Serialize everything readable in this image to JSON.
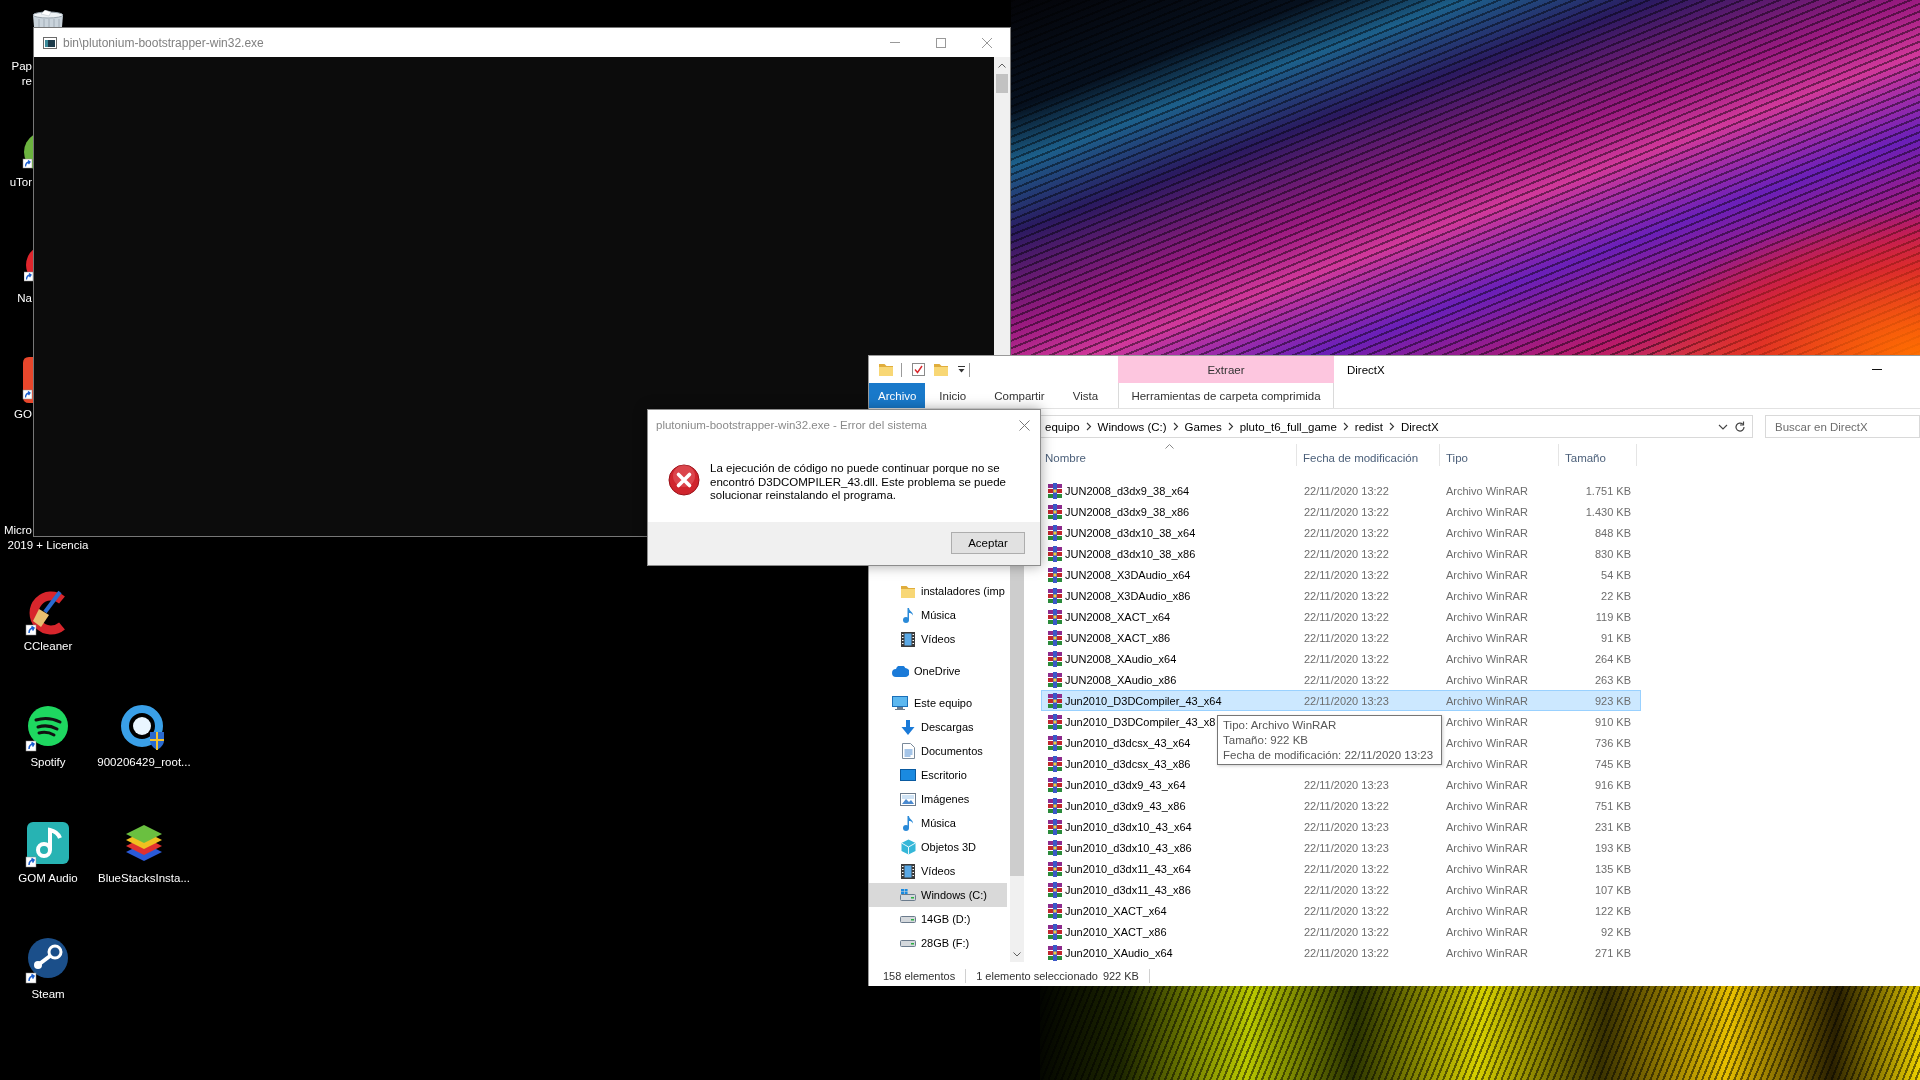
{
  "desktop_icons": [
    {
      "label_lines": [
        "Pap",
        "re"
      ]
    },
    {
      "label_lines": [
        "uTor"
      ]
    },
    {
      "label_lines": [
        "Na"
      ]
    },
    {
      "label_lines": [
        "GO"
      ]
    },
    {
      "label_lines": [
        "Micro",
        "2019 + Licencia"
      ]
    },
    {
      "label_lines": [
        "CCleaner"
      ]
    },
    {
      "label_lines": [
        "Spotify"
      ]
    },
    {
      "label_lines": [
        "900206429_root..."
      ]
    },
    {
      "label_lines": [
        "GOM Audio"
      ]
    },
    {
      "label_lines": [
        "BlueStacksInsta..."
      ]
    },
    {
      "label_lines": [
        "Steam"
      ]
    }
  ],
  "console_window": {
    "title": "bin\\plutonium-bootstrapper-win32.exe"
  },
  "explorer": {
    "title": "DirectX",
    "ribbon": {
      "contextual_group": "Extraer",
      "tabs": [
        {
          "label": "Archivo",
          "kind": "file",
          "selected": false
        },
        {
          "label": "Inicio",
          "kind": "standard",
          "selected": false
        },
        {
          "label": "Compartir",
          "kind": "standard",
          "selected": false
        },
        {
          "label": "Vista",
          "kind": "standard",
          "selected": false
        },
        {
          "label": "Herramientas de carpeta comprimida",
          "kind": "contextual",
          "selected": false
        }
      ]
    },
    "address_bar": {
      "breadcrumbs": [
        "equipo",
        "Windows (C:)",
        "Games",
        "pluto_t6_full_game",
        "redist",
        "DirectX"
      ]
    },
    "search": {
      "placeholder": "Buscar en DirectX"
    },
    "navigation": {
      "quick_access_items": [
        {
          "label": "instaladores (imp",
          "selected": false
        },
        {
          "label": "Música",
          "selected": false
        },
        {
          "label": "Vídeos",
          "selected": false
        }
      ],
      "tree": [
        {
          "label": "OneDrive",
          "selected": false
        },
        {
          "label": "Este equipo",
          "selected": false,
          "children": [
            {
              "label": "Descargas",
              "selected": false
            },
            {
              "label": "Documentos",
              "selected": false
            },
            {
              "label": "Escritorio",
              "selected": false
            },
            {
              "label": "Imágenes",
              "selected": false
            },
            {
              "label": "Música",
              "selected": false
            },
            {
              "label": "Objetos 3D",
              "selected": false
            },
            {
              "label": "Vídeos",
              "selected": false
            },
            {
              "label": "Windows (C:)",
              "selected": true
            },
            {
              "label": "14GB (D:)",
              "selected": false
            },
            {
              "label": "28GB (F:)",
              "selected": false
            }
          ]
        }
      ]
    },
    "file_list": {
      "columns": [
        {
          "label": "Nombre",
          "sorted": true
        },
        {
          "label": "Fecha de modificación",
          "sorted": false
        },
        {
          "label": "Tipo",
          "sorted": false
        },
        {
          "label": "Tamaño",
          "sorted": false
        }
      ],
      "rows": [
        {
          "name": "JUN2008_d3dx9_38_x64",
          "date": "22/11/2020 13:22",
          "type": "Archivo WinRAR",
          "size": "1.751 KB",
          "selected": false
        },
        {
          "name": "JUN2008_d3dx9_38_x86",
          "date": "22/11/2020 13:22",
          "type": "Archivo WinRAR",
          "size": "1.430 KB",
          "selected": false
        },
        {
          "name": "JUN2008_d3dx10_38_x64",
          "date": "22/11/2020 13:22",
          "type": "Archivo WinRAR",
          "size": "848 KB",
          "selected": false
        },
        {
          "name": "JUN2008_d3dx10_38_x86",
          "date": "22/11/2020 13:22",
          "type": "Archivo WinRAR",
          "size": "830 KB",
          "selected": false
        },
        {
          "name": "JUN2008_X3DAudio_x64",
          "date": "22/11/2020 13:22",
          "type": "Archivo WinRAR",
          "size": "54 KB",
          "selected": false
        },
        {
          "name": "JUN2008_X3DAudio_x86",
          "date": "22/11/2020 13:22",
          "type": "Archivo WinRAR",
          "size": "22 KB",
          "selected": false
        },
        {
          "name": "JUN2008_XACT_x64",
          "date": "22/11/2020 13:22",
          "type": "Archivo WinRAR",
          "size": "119 KB",
          "selected": false
        },
        {
          "name": "JUN2008_XACT_x86",
          "date": "22/11/2020 13:22",
          "type": "Archivo WinRAR",
          "size": "91 KB",
          "selected": false
        },
        {
          "name": "JUN2008_XAudio_x64",
          "date": "22/11/2020 13:22",
          "type": "Archivo WinRAR",
          "size": "264 KB",
          "selected": false
        },
        {
          "name": "JUN2008_XAudio_x86",
          "date": "22/11/2020 13:22",
          "type": "Archivo WinRAR",
          "size": "263 KB",
          "selected": false
        },
        {
          "name": "Jun2010_D3DCompiler_43_x64",
          "date": "22/11/2020 13:23",
          "type": "Archivo WinRAR",
          "size": "923 KB",
          "selected": true
        },
        {
          "name": "Jun2010_D3DCompiler_43_x8",
          "type": "Archivo WinRAR",
          "size": "910 KB",
          "selected": false
        },
        {
          "name": "Jun2010_d3dcsx_43_x64",
          "type": "Archivo WinRAR",
          "size": "736 KB",
          "selected": false
        },
        {
          "name": "Jun2010_d3dcsx_43_x86",
          "type": "Archivo WinRAR",
          "size": "745 KB",
          "selected": false
        },
        {
          "name": "Jun2010_d3dx9_43_x64",
          "date": "22/11/2020 13:23",
          "type": "Archivo WinRAR",
          "size": "916 KB",
          "selected": false
        },
        {
          "name": "Jun2010_d3dx9_43_x86",
          "date": "22/11/2020 13:22",
          "type": "Archivo WinRAR",
          "size": "751 KB",
          "selected": false
        },
        {
          "name": "Jun2010_d3dx10_43_x64",
          "date": "22/11/2020 13:23",
          "type": "Archivo WinRAR",
          "size": "231 KB",
          "selected": false
        },
        {
          "name": "Jun2010_d3dx10_43_x86",
          "date": "22/11/2020 13:23",
          "type": "Archivo WinRAR",
          "size": "193 KB",
          "selected": false
        },
        {
          "name": "Jun2010_d3dx11_43_x64",
          "date": "22/11/2020 13:22",
          "type": "Archivo WinRAR",
          "size": "135 KB",
          "selected": false
        },
        {
          "name": "Jun2010_d3dx11_43_x86",
          "date": "22/11/2020 13:22",
          "type": "Archivo WinRAR",
          "size": "107 KB",
          "selected": false
        },
        {
          "name": "Jun2010_XACT_x64",
          "date": "22/11/2020 13:22",
          "type": "Archivo WinRAR",
          "size": "122 KB",
          "selected": false
        },
        {
          "name": "Jun2010_XACT_x86",
          "date": "22/11/2020 13:22",
          "type": "Archivo WinRAR",
          "size": "92 KB",
          "selected": false
        },
        {
          "name": "Jun2010_XAudio_x64",
          "date": "22/11/2020 13:22",
          "type": "Archivo WinRAR",
          "size": "271 KB",
          "selected": false
        }
      ],
      "tooltip": {
        "lines": [
          "Tipo: Archivo WinRAR",
          "Tamaño: 922 KB",
          "Fecha de modificación: 22/11/2020 13:23"
        ]
      }
    },
    "status_bar": {
      "item_count": "158 elementos",
      "selection": "1 elemento seleccionado",
      "selection_size": "922 KB"
    }
  },
  "error_dialog": {
    "title": "plutonium-bootstrapper-win32.exe - Error del sistema",
    "message": "La ejecución de código no puede continuar porque no se encontró D3DCOMPILER_43.dll. Este problema se puede solucionar reinstalando el programa.",
    "button": "Aceptar"
  }
}
